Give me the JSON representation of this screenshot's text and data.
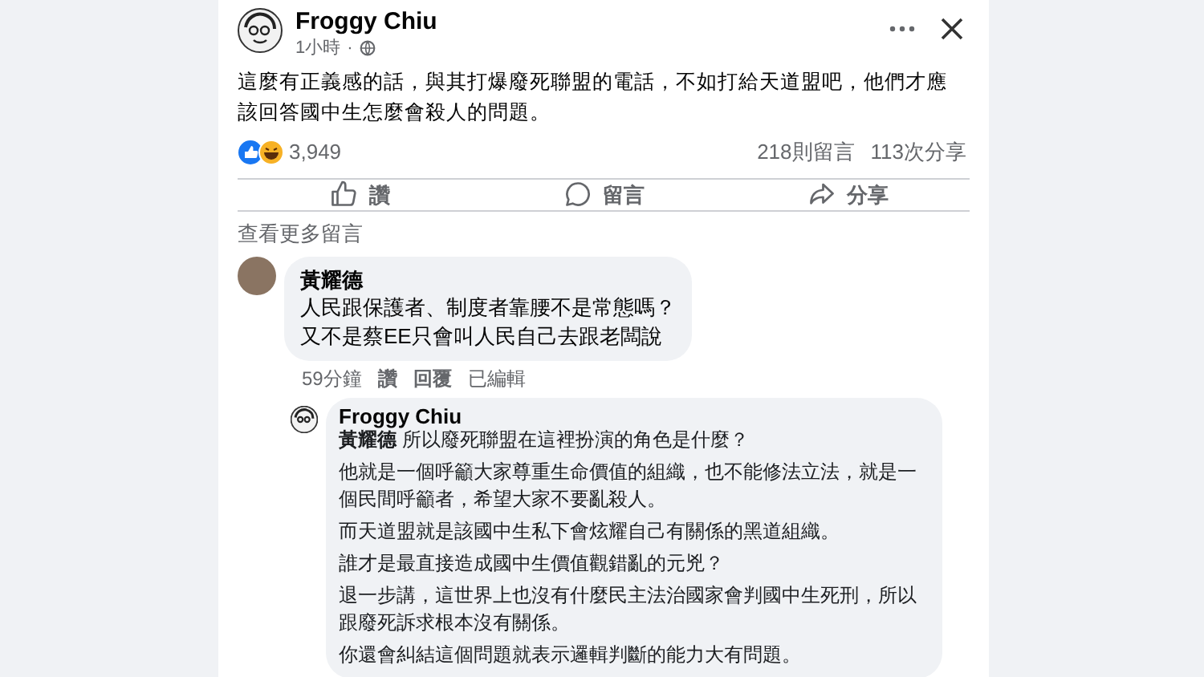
{
  "post": {
    "author": "Froggy Chiu",
    "time": "1小時",
    "separator": "·",
    "text": "這麼有正義感的話，與其打爆廢死聯盟的電話，不如打給天道盟吧，他們才應該回答國中生怎麼會殺人的問題。",
    "reaction_count": "3,949",
    "comments_count": "218則留言",
    "shares_count": "113次分享"
  },
  "actions": [
    {
      "kind": "like",
      "label": "讚"
    },
    {
      "kind": "comment",
      "label": "留言"
    },
    {
      "kind": "share",
      "label": "分享"
    }
  ],
  "more_comments": "查看更多留言",
  "comment": {
    "author": "黃耀德",
    "lines": [
      "人民跟保護者、制度者靠腰不是常態嗎？",
      "又不是蔡EE只會叫人民自己去跟老闆說"
    ],
    "time": "59分鐘",
    "like": "讚",
    "reply": "回覆",
    "edited": "已編輯"
  },
  "reply": {
    "author": "Froggy Chiu",
    "paragraphs": [
      "**黃耀德** 所以廢死聯盟在這裡扮演的角色是什麼？",
      "他就是一個呼籲大家尊重生命價值的組織，也不能修法立法，就是一個民間呼籲者，希望大家不要亂殺人。",
      "而天道盟就是該國中生私下會炫耀自己有關係的黑道組織。",
      "誰才是最直接造成國中生價值觀錯亂的元兇？",
      "退一步講，這世界上也沒有什麼民主法治國家會判國中生死刑，所以跟廢死訴求根本沒有關係。",
      "你還會糾結這個問題就表示邏輯判斷的能力大有問題。"
    ]
  }
}
